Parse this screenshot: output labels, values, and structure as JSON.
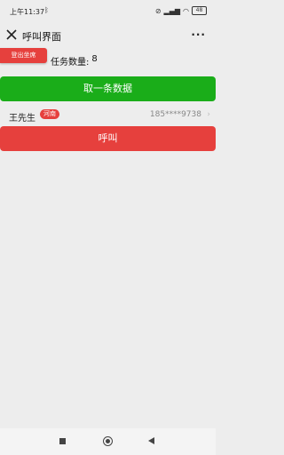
{
  "status_bar": {
    "time": "上午11:37",
    "battery": "48"
  },
  "nav": {
    "title": "呼叫界面",
    "more": "···"
  },
  "logout_label": "登出坐席",
  "task": {
    "label": "任务数量:",
    "count": "8"
  },
  "fetch_button_label": "取一条数据",
  "contact": {
    "name": "王先生",
    "region": "河南",
    "phone": "185****9738"
  },
  "call_button_label": "呼叫",
  "colors": {
    "green": "#1aad19",
    "red": "#e6403d",
    "background": "#ededed"
  }
}
